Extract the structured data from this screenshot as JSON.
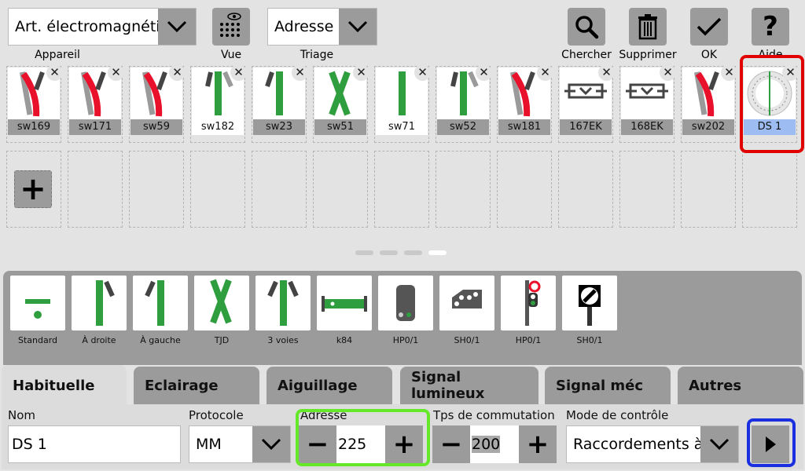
{
  "toolbar": {
    "device_type_value": "Art. électromagnétique",
    "device_label": "Appareil",
    "view_label": "Vue",
    "sort_value": "Adresse",
    "sort_label": "Triage",
    "search_label": "Chercher",
    "delete_label": "Supprimer",
    "ok_label": "OK",
    "help_label": "Aide",
    "help_glyph": "?"
  },
  "articles": [
    {
      "name": "sw169",
      "icon": "switch-left-red-icon"
    },
    {
      "name": "sw171",
      "icon": "switch-left-red-icon"
    },
    {
      "name": "sw59",
      "icon": "switch-left-red-icon"
    },
    {
      "name": "sw182",
      "icon": "switch-right-green-icon"
    },
    {
      "name": "sw23",
      "icon": "switch-left-green-icon"
    },
    {
      "name": "sw51",
      "icon": "double-slip-icon"
    },
    {
      "name": "sw71",
      "icon": "straight-track-icon"
    },
    {
      "name": "sw52",
      "icon": "switch-right-green-icon"
    },
    {
      "name": "sw181",
      "icon": "switch-left-red-icon"
    },
    {
      "name": "167EK",
      "icon": "uncoupler-icon"
    },
    {
      "name": "168EK",
      "icon": "uncoupler-icon"
    },
    {
      "name": "sw202",
      "icon": "switch-left-red-icon"
    },
    {
      "name": "DS 1",
      "icon": "rotary-dial-icon"
    }
  ],
  "add_button_label": "+",
  "close_glyph": "✕",
  "types": [
    {
      "label": "Standard",
      "icon": "standard-icon"
    },
    {
      "label": "À droite",
      "icon": "switch-right-icon"
    },
    {
      "label": "À gauche",
      "icon": "switch-left-icon"
    },
    {
      "label": "TJD",
      "icon": "double-slip-icon"
    },
    {
      "label": "3 voies",
      "icon": "three-way-icon"
    },
    {
      "label": "k84",
      "icon": "decoder-icon"
    },
    {
      "label": "HP0/1",
      "icon": "main-signal-icon"
    },
    {
      "label": "SH0/1",
      "icon": "shunt-signal-icon"
    },
    {
      "label": "HP0/1",
      "icon": "light-signal-icon"
    },
    {
      "label": "SH0/1",
      "icon": "shunt-board-icon"
    }
  ],
  "tabs": [
    "Habituelle",
    "Eclairage",
    "Aiguillage",
    "Signal lumineux",
    "Signal méc",
    "Autres"
  ],
  "form": {
    "name_label": "Nom",
    "name_value": "DS 1",
    "protocol_label": "Protocole",
    "protocol_value": "MM",
    "address_label": "Adresse",
    "address_value": "225",
    "switch_time_label": "Tps de commutation",
    "switch_time_value": "200",
    "control_mode_label": "Mode de contrôle",
    "control_mode_value": "Raccordements à",
    "minus": "−",
    "plus": "+"
  },
  "colors": {
    "red": "#e8102a",
    "green": "#2e9e3e",
    "selected": "#9dbcf2",
    "highlight_red": "#e00000",
    "highlight_green": "#66e82a",
    "highlight_blue": "#1a2fe0"
  }
}
